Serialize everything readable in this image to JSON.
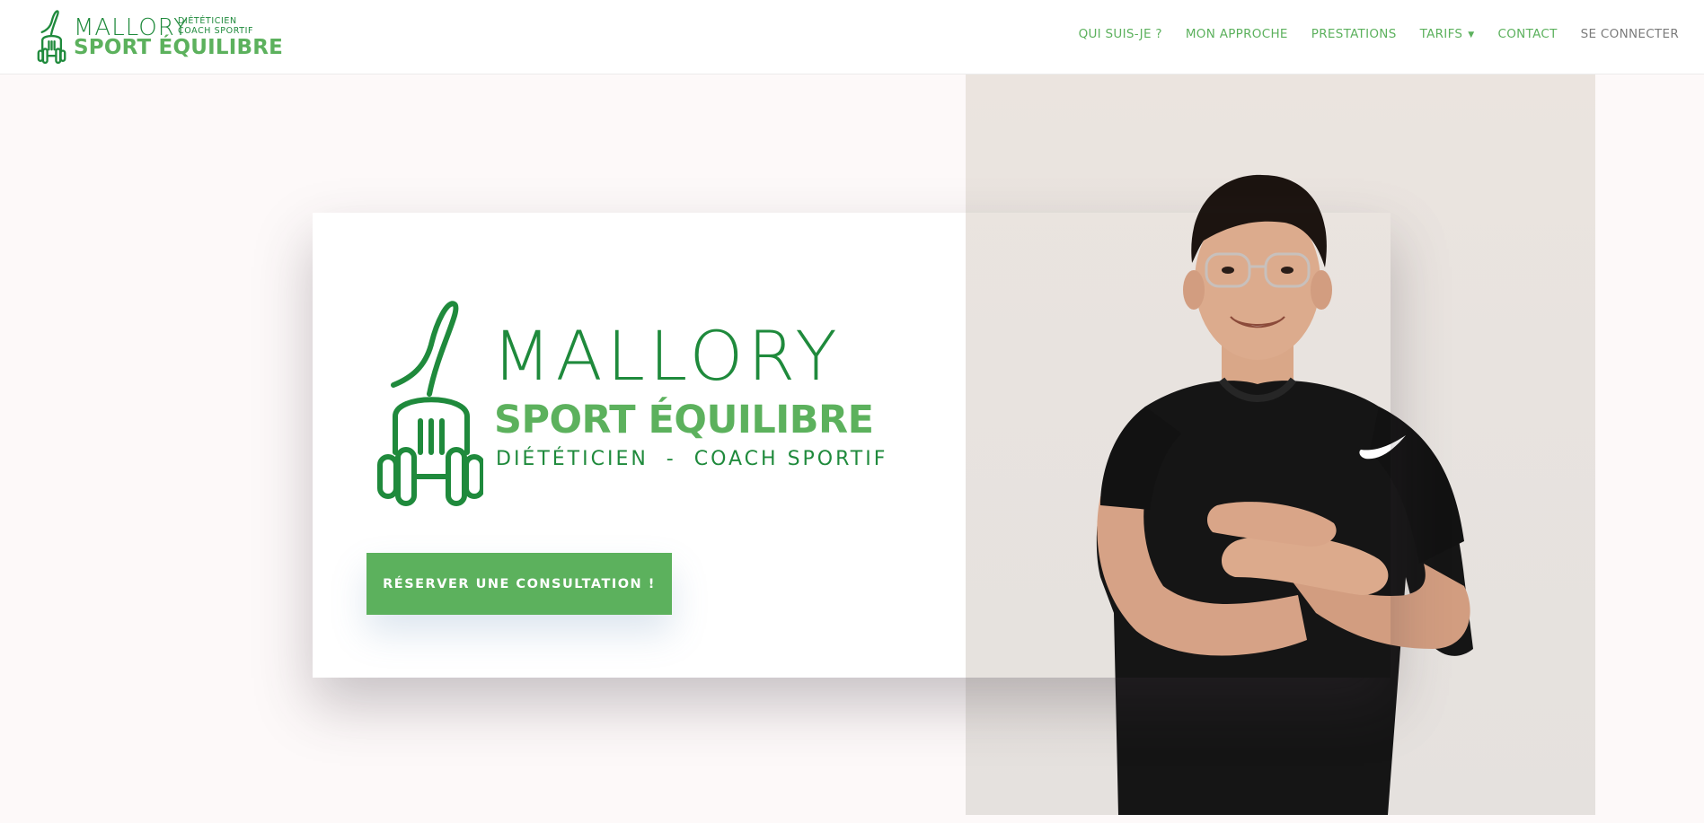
{
  "header": {
    "brand": {
      "name": "MALLORY",
      "tagline_line1": "DIÉTÉTICIEN",
      "tagline_line2": "COACH SPORTIF",
      "subtitle": "SPORT ÉQUILIBRE"
    },
    "nav": [
      {
        "label": "QUI SUIS-JE ?"
      },
      {
        "label": "MON APPROCHE"
      },
      {
        "label": "PRESTATIONS"
      },
      {
        "label": "TARIFS",
        "has_dropdown": true
      },
      {
        "label": "CONTACT"
      },
      {
        "label": "SE CONNECTER"
      }
    ]
  },
  "hero": {
    "logo": {
      "name": "MALLORY",
      "subtitle": "SPORT ÉQUILIBRE",
      "tagline": "DIÉTÉTICIEN  -  COACH SPORTIF"
    },
    "cta_label": "RÉSERVER UNE CONSULTATION !"
  },
  "colors": {
    "brand_dark_green": "#1f8a3c",
    "brand_light_green": "#5cb15d",
    "page_background": "#fdf9f9",
    "nav_muted": "#7b7b7b"
  },
  "icons": {
    "brand_logo": "fork-dumbbell-icon",
    "nav_dropdown": "chevron-down-icon"
  }
}
